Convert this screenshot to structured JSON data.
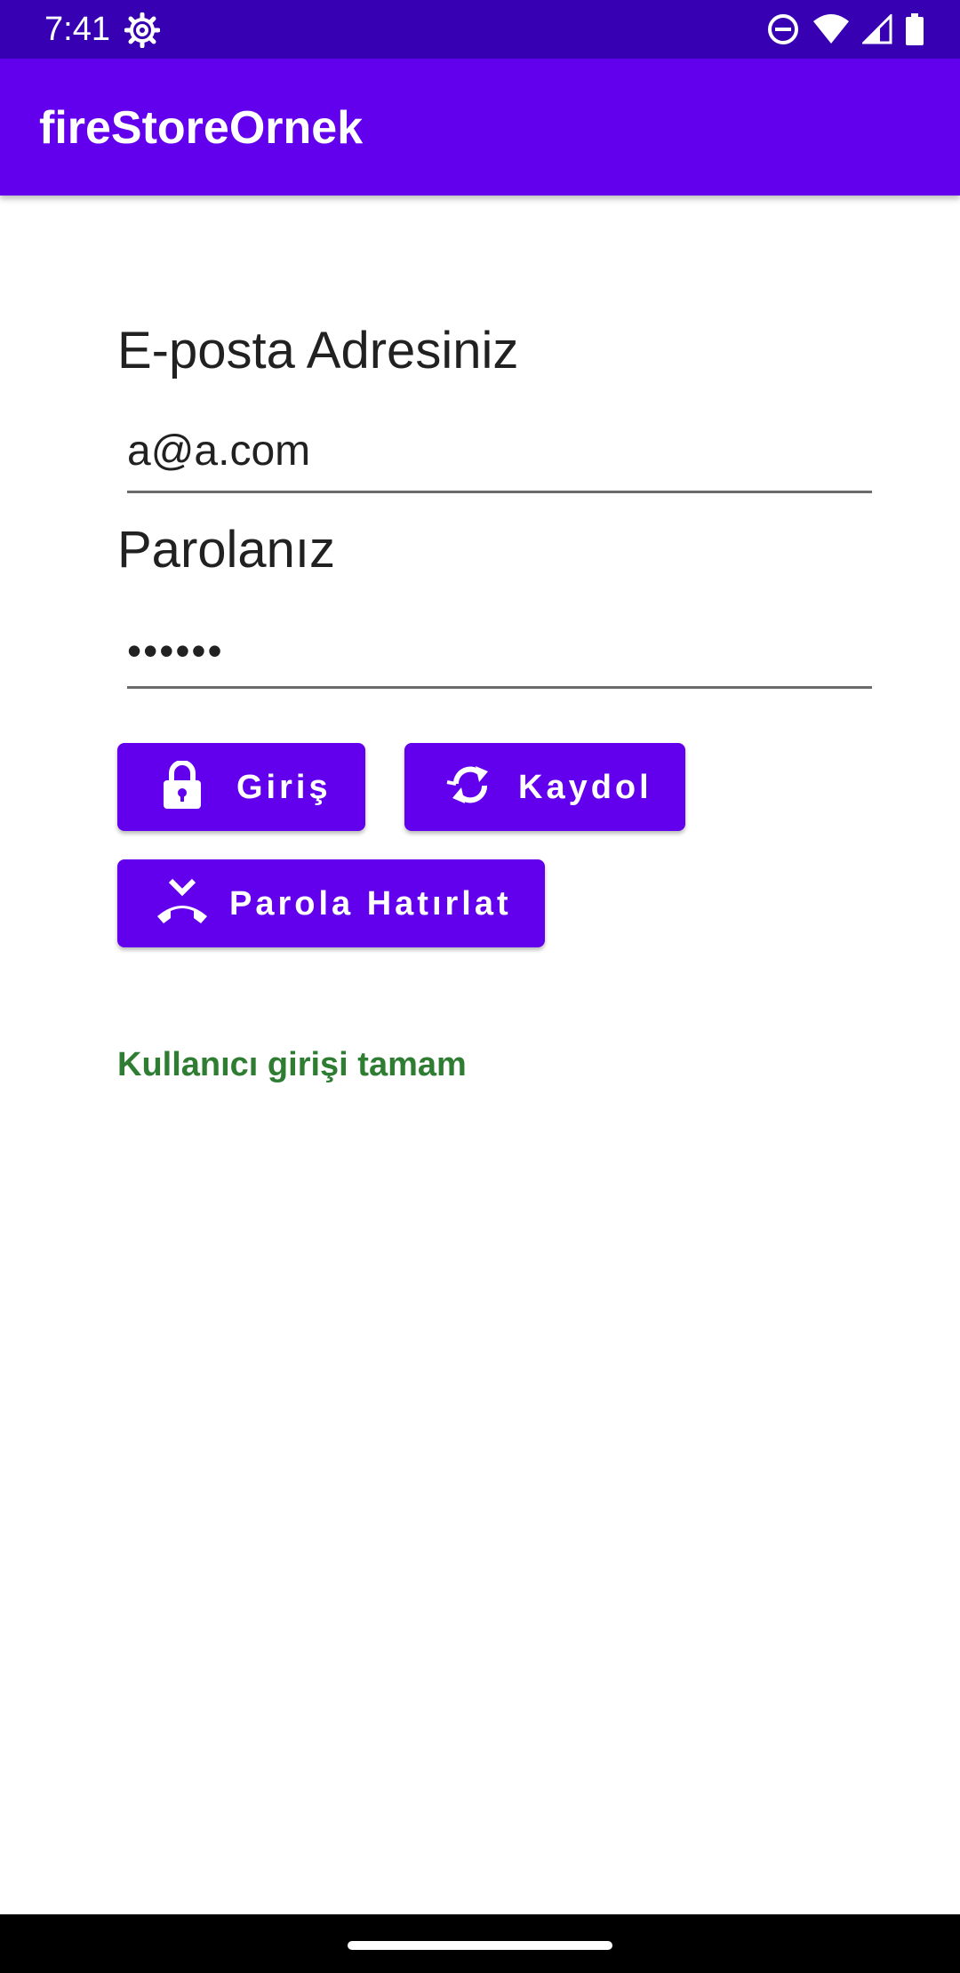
{
  "status_bar": {
    "time": "7:41",
    "icons": [
      "settings-gear-icon",
      "do-not-disturb-icon",
      "wifi-icon",
      "cell-signal-icon",
      "battery-icon"
    ]
  },
  "app_bar": {
    "title": "fireStoreOrnek"
  },
  "form": {
    "email_label": "E-posta Adresiniz",
    "email_value": "a@a.com",
    "password_label": "Parolanız",
    "password_value": "••••••"
  },
  "buttons": {
    "login_label": "Giriş",
    "login_icon": "lock-icon",
    "register_label": "Kaydol",
    "register_icon": "sync-icon",
    "remind_label": "Parola Hatırlat",
    "remind_icon": "call-end-icon"
  },
  "status_message": "Kullanıcı girişi tamam",
  "colors": {
    "status_bar": "#3700b3",
    "primary": "#6200ee",
    "success_text": "#2e7d32"
  }
}
